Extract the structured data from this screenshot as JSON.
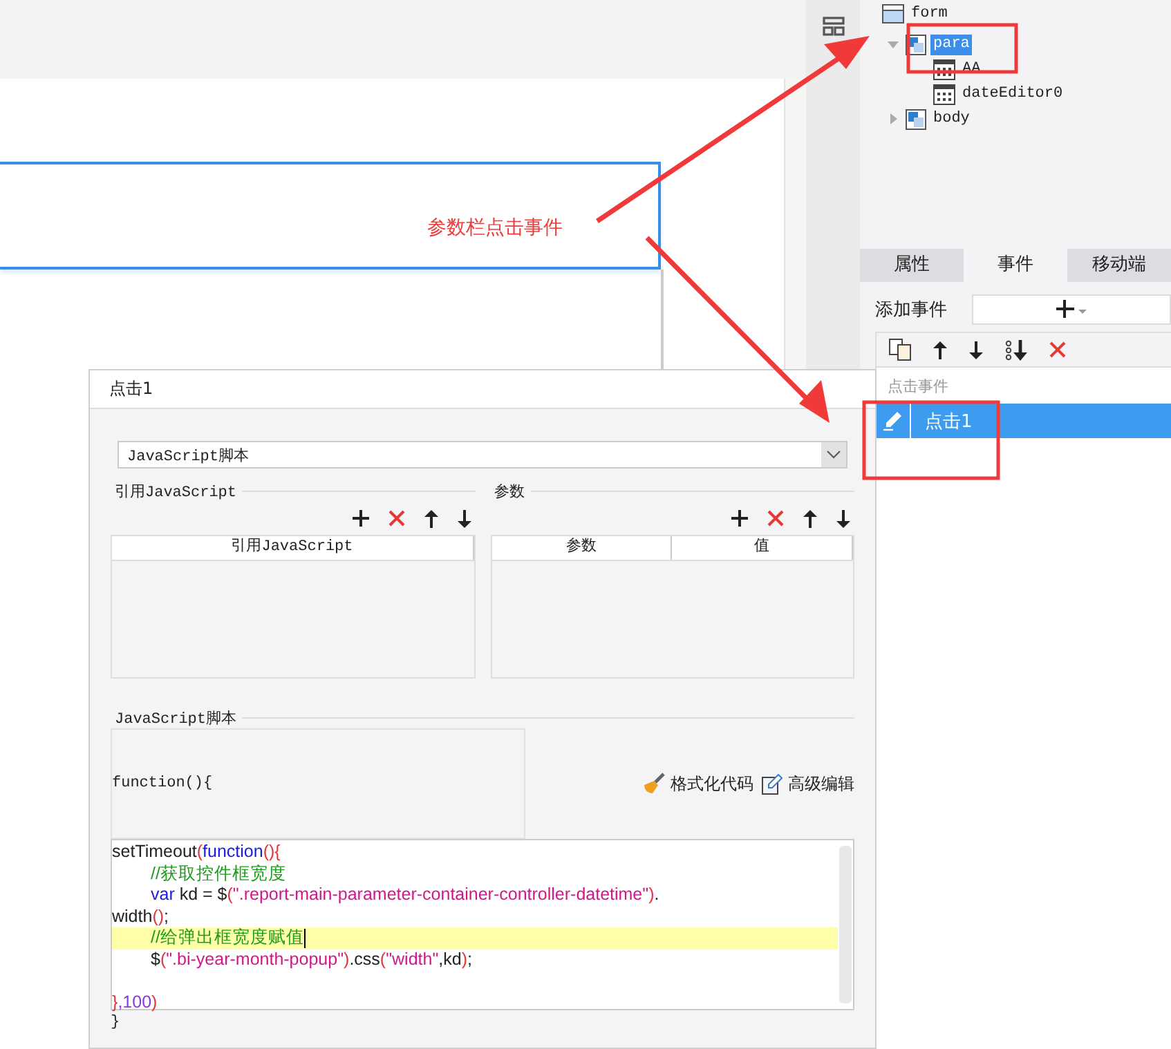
{
  "canvas": {
    "annotation": "参数栏点击事件"
  },
  "tree": [
    {
      "label": "form",
      "kind": "form",
      "selected": false,
      "children": [
        {
          "label": "para",
          "kind": "panel",
          "expanded": true,
          "selected": true,
          "children": [
            {
              "label": "AA",
              "kind": "date",
              "selected": false
            },
            {
              "label": "dateEditor0",
              "kind": "date",
              "selected": false
            }
          ]
        },
        {
          "label": "body",
          "kind": "panel",
          "expanded": false,
          "selected": false
        }
      ]
    }
  ],
  "tabs": [
    {
      "label": "属性",
      "selected": false
    },
    {
      "label": "事件",
      "selected": true
    },
    {
      "label": "移动端",
      "selected": false
    }
  ],
  "add_event": {
    "label": "添加事件"
  },
  "event_list": {
    "header": "点击事件",
    "items": [
      {
        "label": "点击1",
        "selected": true
      }
    ]
  },
  "dialog": {
    "title": "点击1",
    "type_select": {
      "value": "JavaScript脚本"
    },
    "ref_section": {
      "title": "引用JavaScript",
      "columns": [
        "引用JavaScript"
      ]
    },
    "param_section": {
      "title": "参数",
      "columns": [
        "参数",
        "值"
      ]
    },
    "script_section": {
      "title": "JavaScript脚本",
      "header_line": "function(){",
      "footer_line": "}",
      "actions": [
        {
          "label": "格式化代码",
          "kind": "format"
        },
        {
          "label": "高级编辑",
          "kind": "advanced"
        }
      ],
      "code_lines": [
        {
          "indent": false,
          "highlighted": false,
          "tokens": [
            {
              "text": "setTimeout",
              "kind": "plain"
            },
            {
              "text": "(",
              "kind": "paren"
            },
            {
              "text": "function",
              "kind": "keyword"
            },
            {
              "text": "(){",
              "kind": "paren"
            }
          ]
        },
        {
          "indent": true,
          "highlighted": false,
          "tokens": [
            {
              "text": "//获取控件框宽度",
              "kind": "comment"
            }
          ]
        },
        {
          "indent": true,
          "highlighted": false,
          "tokens": [
            {
              "text": "var",
              "kind": "keyword"
            },
            {
              "text": " kd = $",
              "kind": "plain"
            },
            {
              "text": "(",
              "kind": "paren"
            },
            {
              "text": "\".report-main-parameter-container-controller-datetime\"",
              "kind": "string"
            },
            {
              "text": ")",
              "kind": "paren"
            },
            {
              "text": ".",
              "kind": "plain"
            }
          ]
        },
        {
          "indent": false,
          "highlighted": false,
          "tokens": [
            {
              "text": "width",
              "kind": "plain"
            },
            {
              "text": "()",
              "kind": "paren"
            },
            {
              "text": ";",
              "kind": "plain"
            }
          ]
        },
        {
          "indent": true,
          "highlighted": true,
          "tokens": [
            {
              "text": "//给弹出框宽度赋值",
              "kind": "comment"
            }
          ]
        },
        {
          "indent": true,
          "highlighted": false,
          "tokens": [
            {
              "text": "$",
              "kind": "plain"
            },
            {
              "text": "(",
              "kind": "paren"
            },
            {
              "text": "\".bi-year-month-popup\"",
              "kind": "string"
            },
            {
              "text": ")",
              "kind": "paren"
            },
            {
              "text": ".css",
              "kind": "plain"
            },
            {
              "text": "(",
              "kind": "paren"
            },
            {
              "text": "\"width\"",
              "kind": "string"
            },
            {
              "text": ",kd",
              "kind": "plain"
            },
            {
              "text": ")",
              "kind": "paren"
            },
            {
              "text": ";",
              "kind": "plain"
            }
          ]
        },
        {
          "highlighted": false
        },
        {
          "indent": false,
          "highlighted": false,
          "tokens": [
            {
              "text": "}",
              "kind": "paren"
            },
            {
              "text": ",100",
              "kind": "number"
            },
            {
              "text": ")",
              "kind": "paren"
            }
          ]
        }
      ]
    }
  }
}
